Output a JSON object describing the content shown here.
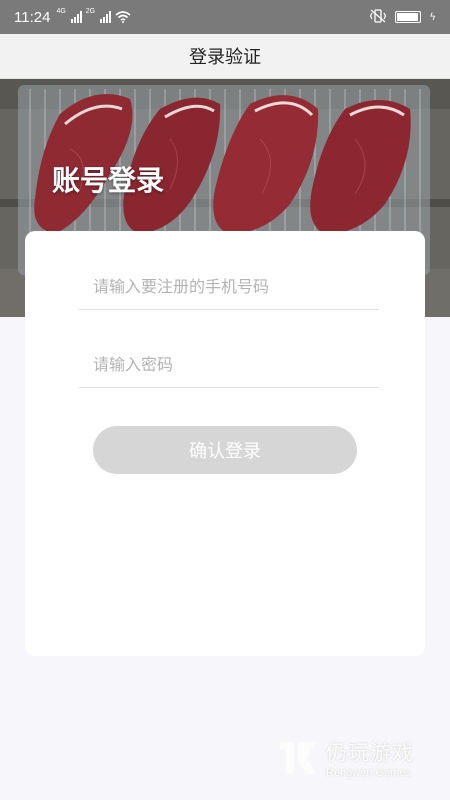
{
  "status_bar": {
    "time": "11:24",
    "signal_tags": [
      "4G",
      "2G"
    ],
    "icons": [
      "signal-icon",
      "signal-icon",
      "wifi-icon",
      "vibrate-icon",
      "battery-icon",
      "charging-icon"
    ]
  },
  "header": {
    "title": "登录验证"
  },
  "hero": {
    "title": "账号登录"
  },
  "form": {
    "phone_placeholder": "请输入要注册的手机号码",
    "password_placeholder": "请输入密码",
    "submit_label": "确认登录"
  },
  "watermark": {
    "text_cn": "仍玩游戏",
    "text_en": "Rengwan Games"
  },
  "colors": {
    "status_bar": "#7a7a7a",
    "header_bg": "#f2f2f2",
    "page_bg": "#f7f7fb",
    "button_disabled": "#d6d6d6",
    "placeholder": "#b3b3b3"
  }
}
